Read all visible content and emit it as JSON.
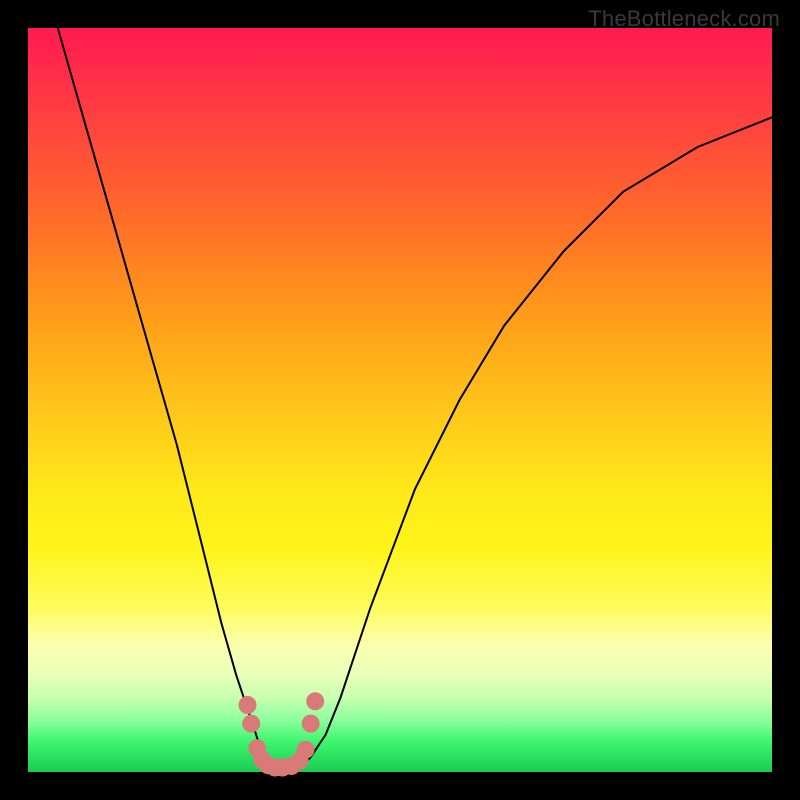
{
  "watermark": "TheBottleneck.com",
  "chart_data": {
    "type": "line",
    "title": "",
    "xlabel": "",
    "ylabel": "",
    "xlim": [
      0,
      100
    ],
    "ylim": [
      0,
      100
    ],
    "series": [
      {
        "name": "curve",
        "x": [
          4,
          8,
          12,
          16,
          20,
          24,
          26,
          28,
          30,
          31,
          32,
          33,
          34,
          35,
          36,
          37,
          38,
          40,
          42,
          46,
          52,
          58,
          64,
          72,
          80,
          90,
          100
        ],
        "y": [
          100,
          86,
          72,
          58,
          44,
          28,
          20,
          13,
          7,
          4,
          2,
          1,
          0.5,
          0.5,
          0.5,
          1,
          2,
          5,
          10,
          22,
          38,
          50,
          60,
          70,
          78,
          84,
          88
        ]
      }
    ],
    "markers": {
      "name": "data-points",
      "x": [
        29.5,
        30.0,
        30.8,
        31.5,
        32.3,
        33.2,
        34.2,
        35.4,
        36.5,
        37.3,
        38.0,
        38.6
      ],
      "y": [
        9.0,
        6.5,
        3.2,
        1.6,
        0.9,
        0.6,
        0.6,
        0.8,
        1.5,
        3.0,
        6.5,
        9.5
      ]
    },
    "background_gradient": {
      "direction": "vertical",
      "stops": [
        {
          "pos": 0.0,
          "color": "#ff1a52"
        },
        {
          "pos": 0.5,
          "color": "#ffd81a"
        },
        {
          "pos": 0.8,
          "color": "#fff51a"
        },
        {
          "pos": 1.0,
          "color": "#18cc52"
        }
      ]
    }
  }
}
